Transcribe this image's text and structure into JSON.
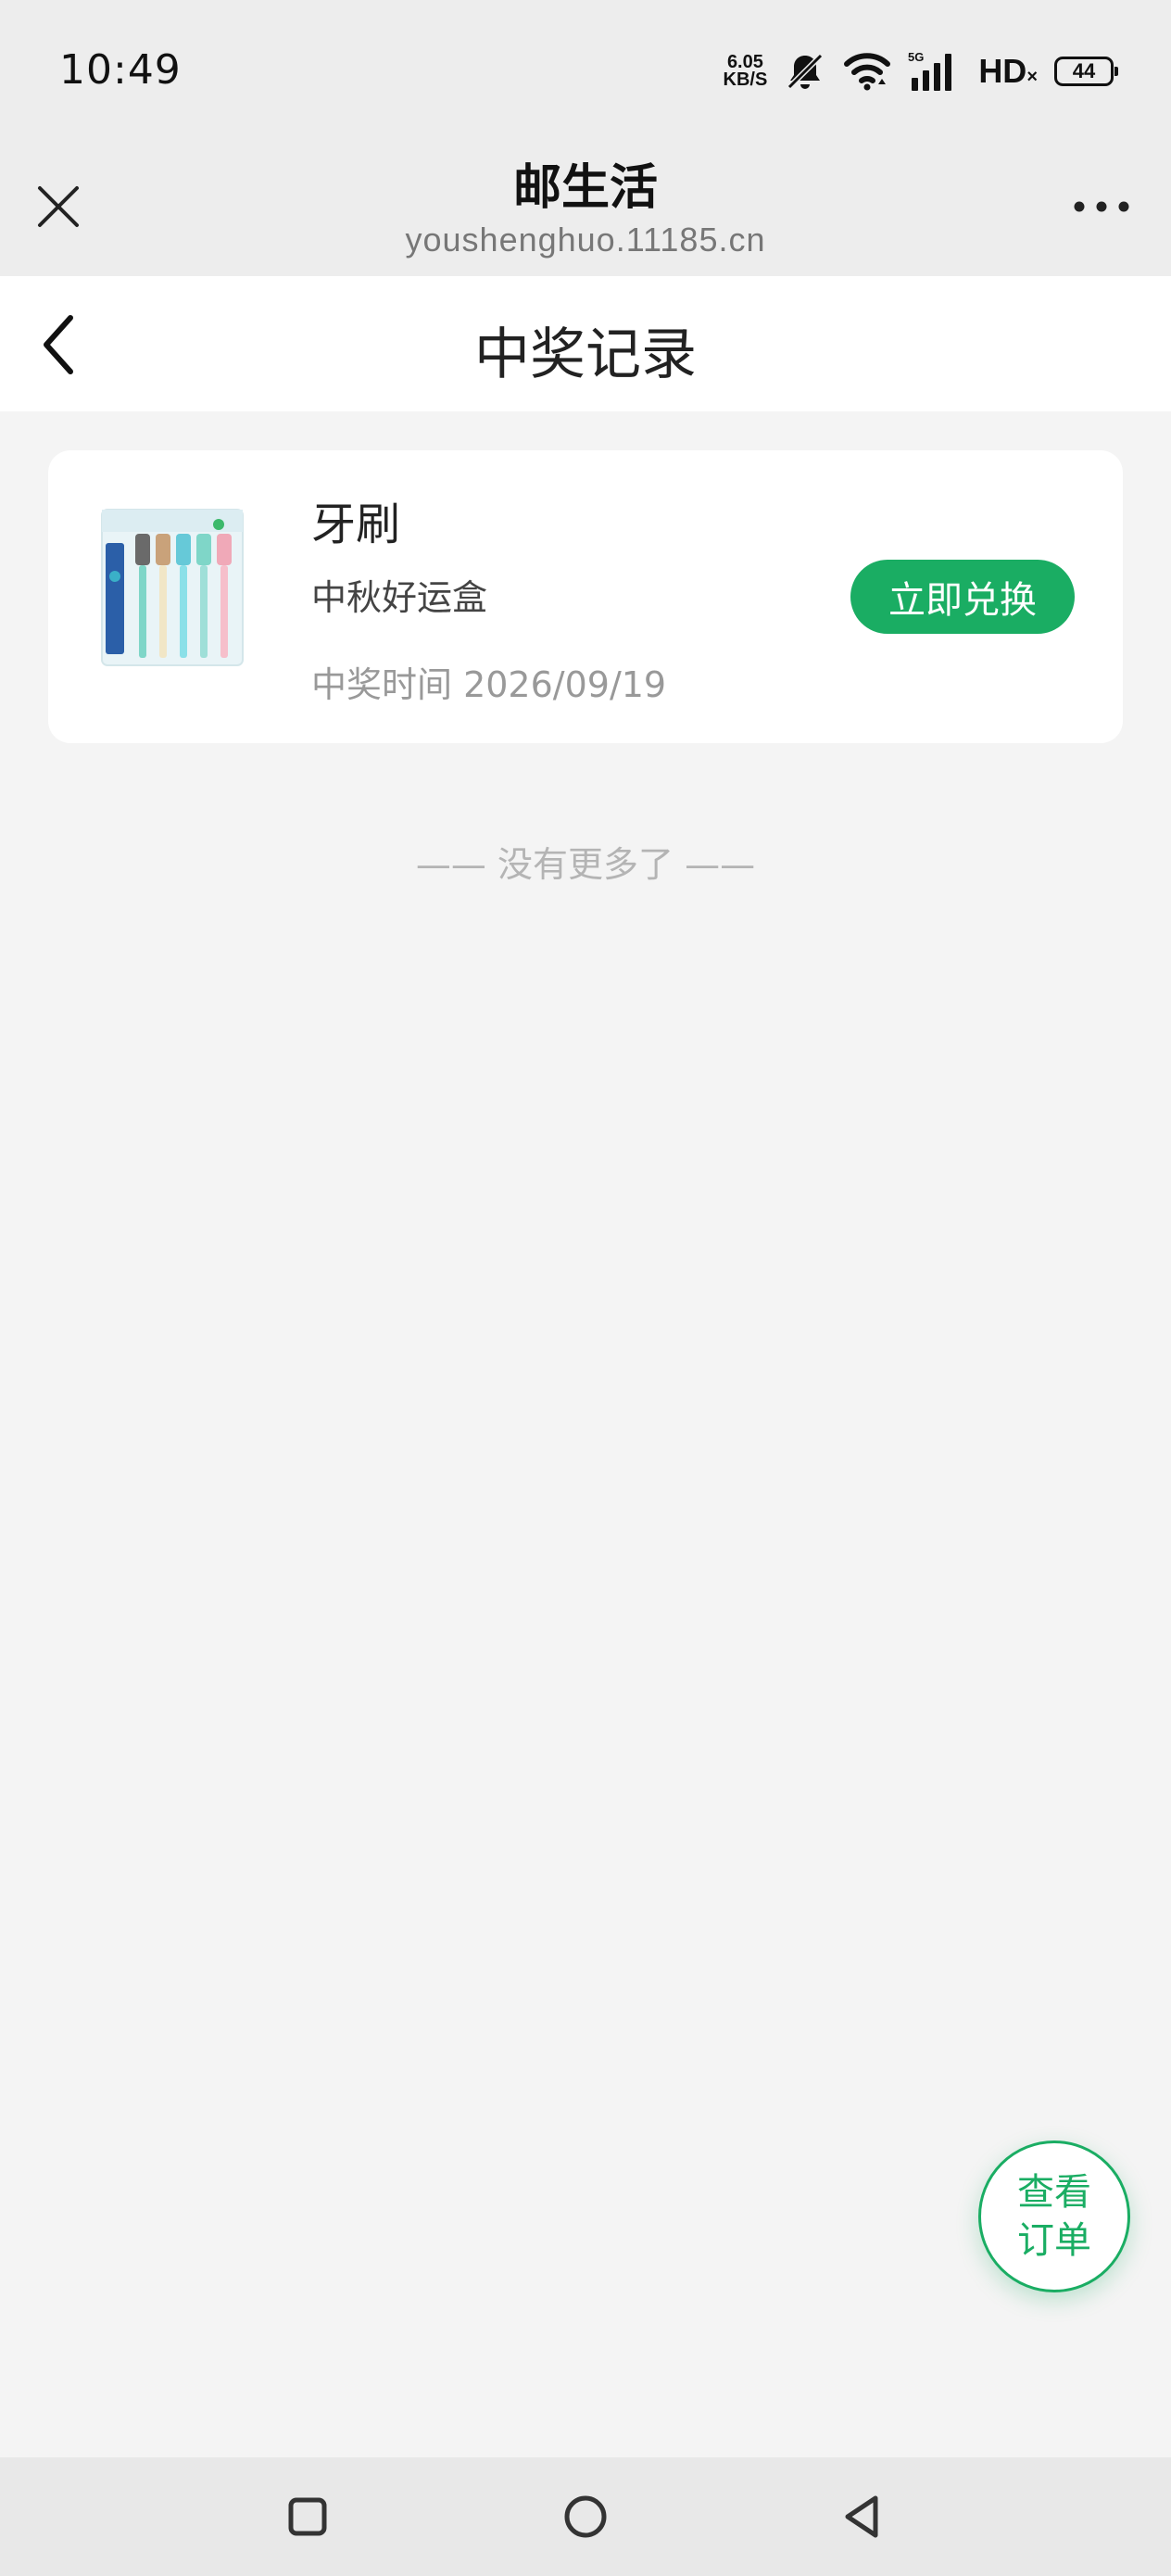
{
  "status_bar": {
    "time": "10:49",
    "net_speed_value": "6.05",
    "net_speed_unit": "KB/S",
    "network_type": "5G",
    "hd_label": "HD",
    "battery_level": "44",
    "icons": [
      "mute-icon",
      "wifi-icon",
      "signal-icon",
      "battery-icon"
    ]
  },
  "webview_bar": {
    "title": "邮生活",
    "url": "youshenghuo.11185.cn",
    "close_icon": "close-icon",
    "more_icon": "more-icon"
  },
  "page_header": {
    "title": "中奖记录",
    "back_icon": "back-arrow-icon"
  },
  "prize_records": [
    {
      "name": "牙刷",
      "activity": "中秋好运盒",
      "time_label": "中奖时间 2026/09/19",
      "action_label": "立即兑换",
      "image": "toothbrush-product-image"
    }
  ],
  "list_end_text": "—— 没有更多了 ——",
  "orders_button": {
    "label": "查看\n订单"
  },
  "nav_bar": {
    "icons": [
      "recent-apps-icon",
      "home-icon",
      "back-icon"
    ]
  },
  "colors": {
    "accent_green": "#1aad63",
    "page_background": "#f4f4f4",
    "title_bar_background": "#ededed",
    "card_background": "#ffffff",
    "muted_text": "#999999"
  }
}
